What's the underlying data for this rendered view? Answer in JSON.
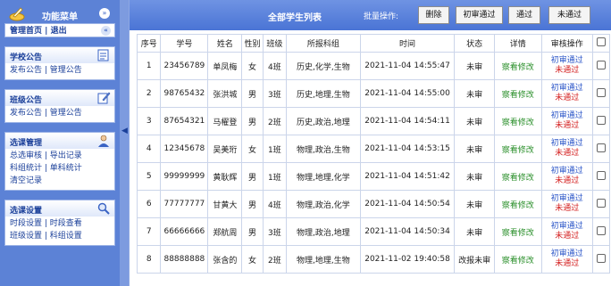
{
  "sidebar": {
    "title": "功能菜单",
    "home": {
      "home_label": "管理首页",
      "separator": "|",
      "logout_label": "退出"
    },
    "panels": [
      {
        "title": "学校公告",
        "links": [
          {
            "label": "发布公告"
          },
          {
            "label": "管理公告"
          }
        ]
      },
      {
        "title": "班级公告",
        "links": [
          {
            "label": "发布公告"
          },
          {
            "label": "管理公告"
          }
        ]
      },
      {
        "title": "选课管理",
        "links": [
          {
            "label": "总选审核"
          },
          {
            "label": "导出记录"
          },
          {
            "label": "科组统计"
          },
          {
            "label": "单科统计"
          },
          {
            "label": "清空记录"
          }
        ]
      },
      {
        "title": "选课设置",
        "links": [
          {
            "label": "时段设置"
          },
          {
            "label": "时段查看"
          },
          {
            "label": "班级设置"
          },
          {
            "label": "科组设置"
          }
        ]
      }
    ]
  },
  "main": {
    "title": "全部学生列表",
    "batch_label": "批量操作:",
    "buttons": {
      "delete": "删除",
      "first_pass": "初审通过",
      "pass": "通过",
      "fail": "未通过"
    },
    "columns": [
      "序号",
      "学号",
      "姓名",
      "性别",
      "班级",
      "所报科组",
      "时间",
      "状态",
      "详情",
      "审核操作",
      ""
    ],
    "rows": [
      {
        "no": "1",
        "id": "23456789",
        "name": "单凤梅",
        "gender": "女",
        "class": "4班",
        "subjects": "历史,化学,生物",
        "time": "2021-11-04 14:55:47",
        "status": "未审",
        "detail": "察看修改",
        "op1": "初审通过",
        "op2": "未通过"
      },
      {
        "no": "2",
        "id": "98765432",
        "name": "张洪城",
        "gender": "男",
        "class": "3班",
        "subjects": "历史,地理,生物",
        "time": "2021-11-04 14:55:00",
        "status": "未审",
        "detail": "察看修改",
        "op1": "初审通过",
        "op2": "未通过"
      },
      {
        "no": "3",
        "id": "87654321",
        "name": "马櫂登",
        "gender": "男",
        "class": "2班",
        "subjects": "历史,政治,地理",
        "time": "2021-11-04 14:54:11",
        "status": "未审",
        "detail": "察看修改",
        "op1": "初审通过",
        "op2": "未通过"
      },
      {
        "no": "4",
        "id": "12345678",
        "name": "吴美珩",
        "gender": "女",
        "class": "1班",
        "subjects": "物理,政治,生物",
        "time": "2021-11-04 14:53:15",
        "status": "未审",
        "detail": "察看修改",
        "op1": "初审通过",
        "op2": "未通过"
      },
      {
        "no": "5",
        "id": "99999999",
        "name": "黄耿辉",
        "gender": "男",
        "class": "1班",
        "subjects": "物理,地理,化学",
        "time": "2021-11-04 14:51:42",
        "status": "未审",
        "detail": "察看修改",
        "op1": "初审通过",
        "op2": "未通过"
      },
      {
        "no": "6",
        "id": "77777777",
        "name": "甘黄大",
        "gender": "男",
        "class": "4班",
        "subjects": "物理,政治,化学",
        "time": "2021-11-04 14:50:54",
        "status": "未审",
        "detail": "察看修改",
        "op1": "初审通过",
        "op2": "未通过"
      },
      {
        "no": "7",
        "id": "66666666",
        "name": "郑航周",
        "gender": "男",
        "class": "3班",
        "subjects": "物理,政治,地理",
        "time": "2021-11-04 14:50:34",
        "status": "未审",
        "detail": "察看修改",
        "op1": "初审通过",
        "op2": "未通过"
      },
      {
        "no": "8",
        "id": "88888888",
        "name": "张含的",
        "gender": "女",
        "class": "2班",
        "subjects": "物理,地理,生物",
        "time": "2021-11-02 19:40:58",
        "status": "改报未审",
        "detail": "察看修改",
        "op1": "初审通过",
        "op2": "未通过"
      }
    ]
  },
  "colors": {
    "sidebar_bg": "#5c82d6",
    "topbar": "#4a74d5",
    "link_green": "#2a8f2a",
    "op_blue": "#2a55c8",
    "op_red": "#d42020"
  }
}
